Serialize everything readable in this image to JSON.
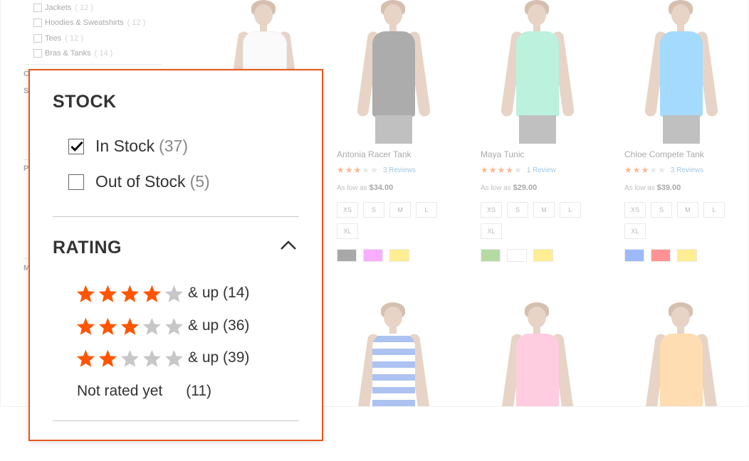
{
  "categories": [
    {
      "label": "Jackets",
      "count": "( 12 )"
    },
    {
      "label": "Hoodies & Sweatshirts",
      "count": "( 12 )"
    },
    {
      "label": "Tees",
      "count": "( 12 )"
    },
    {
      "label": "Bras & Tanks",
      "count": "( 14 )"
    }
  ],
  "sidebar_letters": [
    "C",
    "S",
    "P",
    "M"
  ],
  "products": [
    {
      "name": "Antonia Racer Tank",
      "stars": 3,
      "reviews": "3 Reviews",
      "price_prefix": "As low as",
      "price": "$34.00",
      "sizes": [
        "XS",
        "S",
        "M",
        "L",
        "XL"
      ],
      "swatches": [
        "#333333",
        "#ef3dff",
        "#ffd500"
      ],
      "top_color": "#3c3c3c"
    },
    {
      "name": "Maya Tunic",
      "stars": 4,
      "reviews": "1 Review",
      "price_prefix": "As low as",
      "price": "$29.00",
      "sizes": [
        "XS",
        "S",
        "M",
        "L",
        "XL"
      ],
      "swatches": [
        "#53a828",
        "#ffffff",
        "#ffd500"
      ],
      "top_color": "#5fe0b0"
    },
    {
      "name": "Chloe Compete Tank",
      "stars": 3.5,
      "reviews": "3 Reviews",
      "price_prefix": "As low as",
      "price": "$39.00",
      "sizes": [
        "XS",
        "S",
        "M",
        "L",
        "XL"
      ],
      "swatches": [
        "#1857f7",
        "#ff0000",
        "#ffd500"
      ],
      "top_color": "#2aa8ff"
    }
  ],
  "filter": {
    "stock": {
      "title": "STOCK",
      "options": [
        {
          "label": "In Stock",
          "count": "(37)",
          "checked": true
        },
        {
          "label": "Out of Stock",
          "count": "(5)",
          "checked": false
        }
      ]
    },
    "rating": {
      "title": "RATING",
      "rows": [
        {
          "stars": 4,
          "label": "& up (14)"
        },
        {
          "stars": 3,
          "label": "& up (36)"
        },
        {
          "stars": 2,
          "label": "& up (39)"
        }
      ],
      "not_rated": {
        "label": "Not rated yet",
        "count": "(11)"
      }
    }
  },
  "colors": {
    "accent": "#e8561c",
    "star_on": "#ff5501",
    "star_off": "#c7c7c7"
  },
  "icons": {
    "checkbox_checked": "check-icon",
    "collapse": "chevron-up-icon",
    "star": "star-icon"
  }
}
